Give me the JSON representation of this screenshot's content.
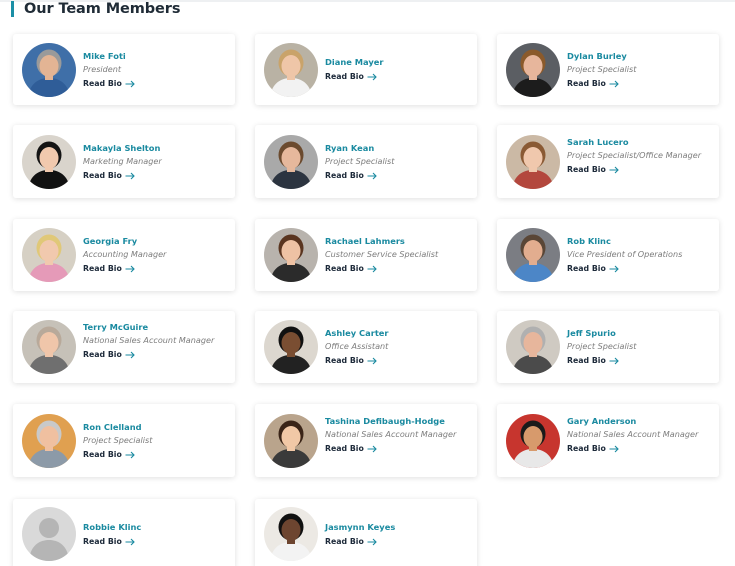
{
  "section_title": "Our Team Members",
  "read_bio_label": "Read Bio",
  "colors": {
    "accent": "#1a8aa0",
    "heading": "#1f2b36",
    "link": "#1d2a3a",
    "muted": "#7d7d7d"
  },
  "members": [
    {
      "name": "Mike Foti",
      "title": "President"
    },
    {
      "name": "Diane Mayer",
      "title": ""
    },
    {
      "name": "Dylan Burley",
      "title": "Project Specialist"
    },
    {
      "name": "Makayla Shelton",
      "title": "Marketing Manager"
    },
    {
      "name": "Ryan Kean",
      "title": "Project Specialist"
    },
    {
      "name": "Sarah Lucero",
      "title": "Project Specialist/Office Manager"
    },
    {
      "name": "Georgia Fry",
      "title": "Accounting Manager"
    },
    {
      "name": "Rachael Lahmers",
      "title": "Customer Service Specialist"
    },
    {
      "name": "Rob Klinc",
      "title": "Vice President of Operations"
    },
    {
      "name": "Terry McGuire",
      "title": "National Sales Account Manager"
    },
    {
      "name": "Ashley Carter",
      "title": "Office Assistant"
    },
    {
      "name": "Jeff Spurio",
      "title": "Project Specialist"
    },
    {
      "name": "Ron Clelland",
      "title": "Project Specialist"
    },
    {
      "name": "Tashina Defibaugh-Hodge",
      "title": "National Sales Account Manager"
    },
    {
      "name": "Gary Anderson",
      "title": "National Sales Account Manager"
    },
    {
      "name": "Robbie Klinc",
      "title": ""
    },
    {
      "name": "Jasmynn Keyes",
      "title": ""
    }
  ]
}
